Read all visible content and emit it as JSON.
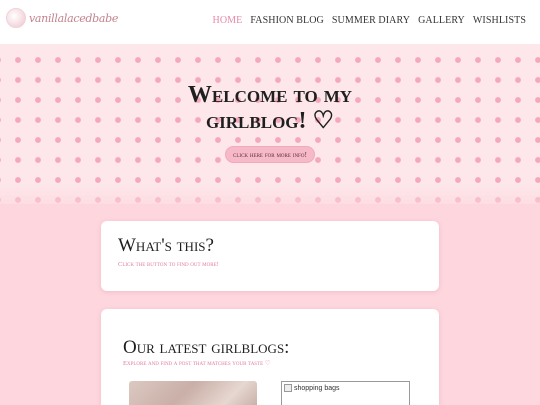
{
  "header": {
    "logo_text": "vanillalacedbabe",
    "nav": [
      {
        "label": "HOME",
        "active": true
      },
      {
        "label": "FASHION BLOG",
        "active": false
      },
      {
        "label": "SUMMER DIARY",
        "active": false
      },
      {
        "label": "GALLERY",
        "active": false
      },
      {
        "label": "WISHLISTS",
        "active": false
      }
    ]
  },
  "hero": {
    "title_line1": "Welcome to my",
    "title_line2": "girlblog! ♡",
    "button_label": "click here for more info!"
  },
  "whats_this": {
    "title": "What's this?",
    "subtitle": "Click the button to find out more!"
  },
  "latest": {
    "title": "Our latest girlblogs:",
    "subtitle": "Explore and find a post that matches your taste ♡",
    "image_right_alt": "shopping bags"
  },
  "colors": {
    "accent": "#e58aa6",
    "background": "#fdd6de",
    "hero_dots": "#f3a9bb"
  }
}
